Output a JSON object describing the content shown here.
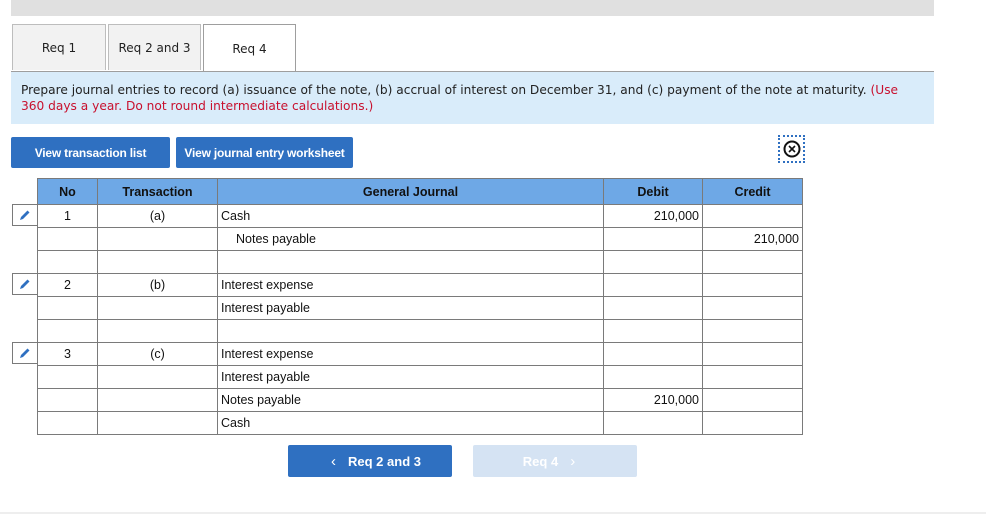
{
  "tabs": [
    {
      "label": "Req 1",
      "active": false
    },
    {
      "label": "Req 2 and 3",
      "active": false
    },
    {
      "label": "Req 4",
      "active": true
    }
  ],
  "instructions": {
    "text": "Prepare journal entries to record (a) issuance of the note, (b) accrual of interest on December 31, and (c) payment of the note at maturity.",
    "note": "(Use 360 days a year. Do not round intermediate calculations.)"
  },
  "buttons": {
    "view_transaction_list": "View transaction list",
    "view_journal_entry_worksheet": "View journal entry worksheet"
  },
  "icons": {
    "close": "⊗",
    "edit": "pencil-icon"
  },
  "table": {
    "headers": {
      "no": "No",
      "transaction": "Transaction",
      "general_journal": "General Journal",
      "debit": "Debit",
      "credit": "Credit"
    },
    "rows": [
      {
        "no": "1",
        "transaction": "(a)",
        "account": "Cash",
        "indent": false,
        "debit": "210,000",
        "credit": ""
      },
      {
        "no": "",
        "transaction": "",
        "account": "Notes payable",
        "indent": true,
        "debit": "",
        "credit": "210,000"
      },
      {
        "no": "",
        "transaction": "",
        "account": "",
        "indent": false,
        "debit": "",
        "credit": ""
      },
      {
        "no": "2",
        "transaction": "(b)",
        "account": "Interest expense",
        "indent": false,
        "debit": "",
        "credit": ""
      },
      {
        "no": "",
        "transaction": "",
        "account": "Interest payable",
        "indent": false,
        "debit": "",
        "credit": ""
      },
      {
        "no": "",
        "transaction": "",
        "account": "",
        "indent": false,
        "debit": "",
        "credit": ""
      },
      {
        "no": "3",
        "transaction": "(c)",
        "account": "Interest expense",
        "indent": false,
        "debit": "",
        "credit": ""
      },
      {
        "no": "",
        "transaction": "",
        "account": "Interest payable",
        "indent": false,
        "debit": "",
        "credit": ""
      },
      {
        "no": "",
        "transaction": "",
        "account": "Notes payable",
        "indent": false,
        "debit": "210,000",
        "credit": ""
      },
      {
        "no": "",
        "transaction": "",
        "account": "Cash",
        "indent": false,
        "debit": "",
        "credit": ""
      }
    ]
  },
  "navigation": {
    "prev_label": "Req 2 and 3",
    "next_label": "Req 4",
    "prev_chevron": "‹",
    "next_chevron": "›"
  },
  "colors": {
    "accent": "#2f70c1",
    "header_blue": "#6ea8e6",
    "instruction_bg": "#d9ecfa",
    "note_red": "#c8102e"
  }
}
